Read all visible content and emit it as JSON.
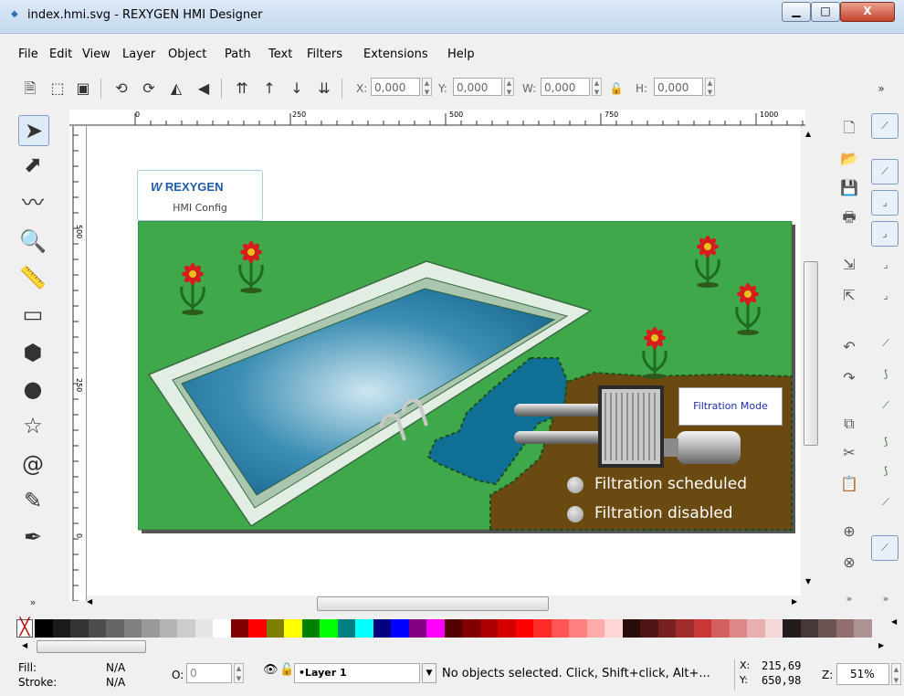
{
  "window": {
    "title": "index.hmi.svg - REXYGEN HMI Designer",
    "minimize": "▁",
    "maximize": "□",
    "close": "X"
  },
  "menu": [
    "File",
    "Edit",
    "View",
    "Layer",
    "Object",
    "Path",
    "Text",
    "Filters",
    "Extensions",
    "Help"
  ],
  "commandbar": {
    "x_label": "X:",
    "x_value": "0,000",
    "y_label": "Y:",
    "y_value": "0,000",
    "w_label": "W:",
    "w_value": "0,000",
    "h_label": "H:",
    "h_value": "0,000",
    "overflow": "»"
  },
  "ruler": {
    "h_labels": [
      "0",
      "250",
      "500",
      "750",
      "1000"
    ],
    "v_labels": [
      "500",
      "250",
      "0"
    ]
  },
  "logo": {
    "brand": "REXYGEN",
    "subtitle": "HMI Config"
  },
  "hmi": {
    "filtration_mode_label": "Filtration Mode",
    "status_items": [
      "Filtration scheduled",
      "Filtration disabled"
    ]
  },
  "toolbox_overflow": "»",
  "palette": {
    "colors": [
      "#000000",
      "#1a1a1a",
      "#333333",
      "#4d4d4d",
      "#666666",
      "#808080",
      "#999999",
      "#b3b3b3",
      "#cccccc",
      "#e6e6e6",
      "#ffffff",
      "#800000",
      "#ff0000",
      "#808000",
      "#ffff00",
      "#008000",
      "#00ff00",
      "#008080",
      "#00ffff",
      "#000080",
      "#0000ff",
      "#800080",
      "#ff00ff",
      "#550000",
      "#800000",
      "#aa0000",
      "#d40000",
      "#ff0000",
      "#ff2a2a",
      "#ff5555",
      "#ff8080",
      "#ffaaaa",
      "#ffd5d5",
      "#280b0b",
      "#501616",
      "#782121",
      "#a02c2c",
      "#c83737",
      "#d35f5f",
      "#de8787",
      "#e9afaf",
      "#f4d7d7",
      "#241c1c",
      "#483737",
      "#6c5353",
      "#916f6f",
      "#ac9393"
    ]
  },
  "status": {
    "fill_label": "Fill:",
    "fill_value": "N/A",
    "stroke_label": "Stroke:",
    "stroke_value": "N/A",
    "opacity_label": "O:",
    "opacity_value": "0",
    "layer": "•Layer 1",
    "message": "No objects selected. Click, Shift+click, Alt+...",
    "x_label": "X:",
    "x_value": "215,69",
    "y_label": "Y:",
    "y_value": "650,98",
    "zoom_label": "Z:",
    "zoom_value": "51%"
  }
}
